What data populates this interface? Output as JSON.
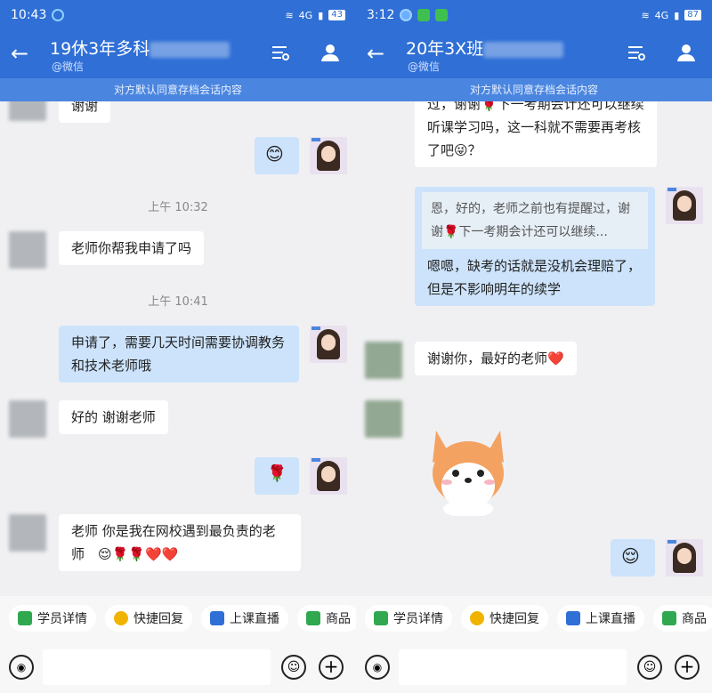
{
  "left": {
    "status": {
      "time": "10:43",
      "battery": "43",
      "net": "4G"
    },
    "header": {
      "title": "19休3年多科",
      "subtitle": "@微信"
    },
    "banner": "对方默认同意存档会话内容",
    "messages": {
      "m1": "谢谢",
      "m2": "😊",
      "ts1": "上午 10:32",
      "m3": "老师你帮我申请了吗",
      "ts2": "上午 10:41",
      "m4": "申请了，需要几天时间需要协调教务和技术老师哦",
      "m5": "好的 谢谢老师",
      "m6": "🌹",
      "m7": "老师 你是我在网校遇到最负责的老师　😌🌹🌹❤️❤️"
    }
  },
  "right": {
    "status": {
      "time": "3:12",
      "battery": "87",
      "net": "4G"
    },
    "header": {
      "title": "20年3X班",
      "subtitle": "@微信"
    },
    "banner": "对方默认同意存档会话内容",
    "messages": {
      "m1": "过，谢谢🌹下一考期会计还可以继续听课学习吗，这一科就不需要再考核了吧😜？",
      "quote": "恩，好的，老师之前也有提醒过，谢谢🌹下一考期会计还可以继续...",
      "m2": "嗯嗯，缺考的话就是没机会理赔了，但是不影响明年的续学",
      "m3": "谢谢你，最好的老师❤️",
      "m4": "😌"
    }
  },
  "chips": [
    "学员详情",
    "快捷回复",
    "上课直播",
    "商品"
  ],
  "colors": {
    "header": "#2f6fd6",
    "banner": "#4a86e0",
    "bubble_right": "#cce3fb"
  }
}
